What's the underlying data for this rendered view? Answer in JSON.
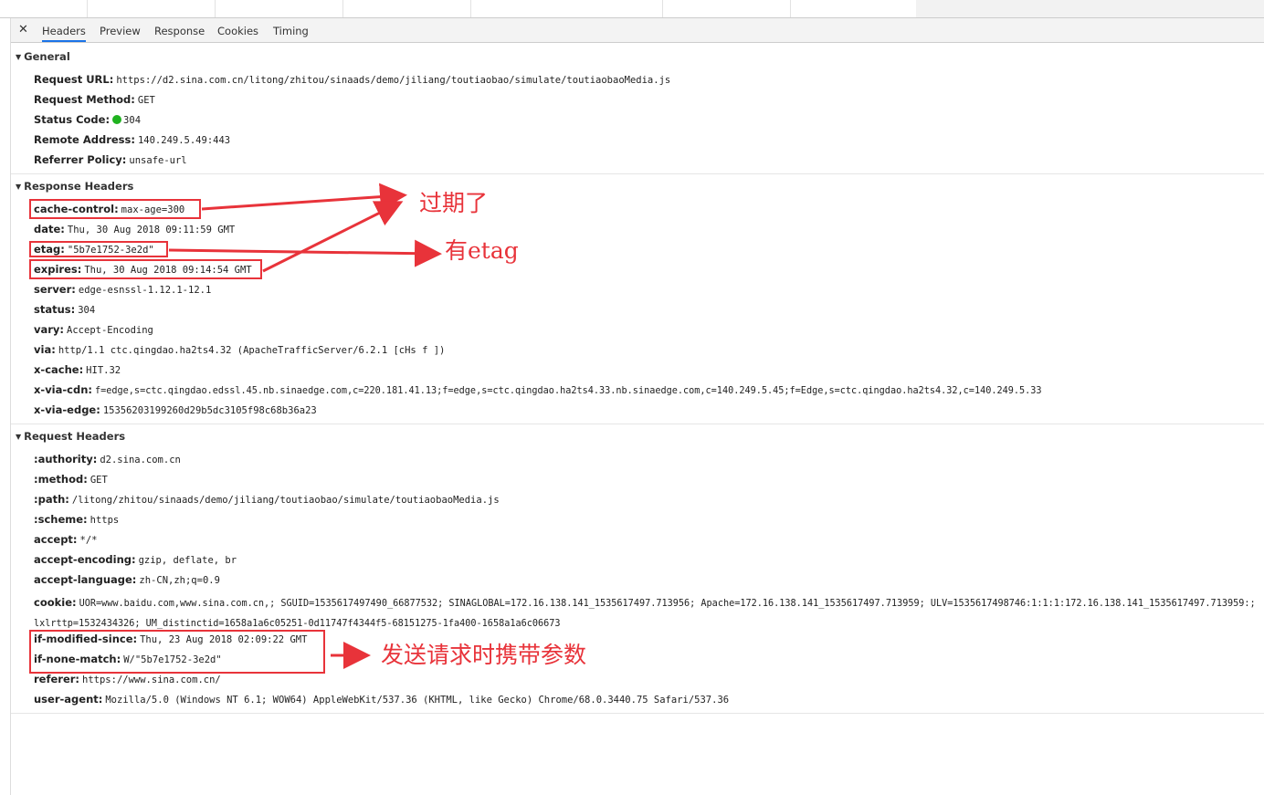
{
  "tabs": {
    "close": "✕",
    "headers": "Headers",
    "preview": "Preview",
    "response": "Response",
    "cookies": "Cookies",
    "timing": "Timing"
  },
  "general": {
    "title": "General",
    "rows": [
      {
        "key": "Request URL:",
        "value": "https://d2.sina.com.cn/litong/zhitou/sinaads/demo/jiliang/toutiaobao/simulate/toutiaobaoMedia.js"
      },
      {
        "key": "Request Method:",
        "value": "GET"
      },
      {
        "key": "Status Code:",
        "value": "304"
      },
      {
        "key": "Remote Address:",
        "value": "140.249.5.49:443"
      },
      {
        "key": "Referrer Policy:",
        "value": "unsafe-url"
      }
    ]
  },
  "response": {
    "title": "Response Headers",
    "rows": [
      {
        "key": "cache-control:",
        "value": "max-age=300"
      },
      {
        "key": "date:",
        "value": "Thu, 30 Aug 2018 09:11:59 GMT"
      },
      {
        "key": "etag:",
        "value": "\"5b7e1752-3e2d\""
      },
      {
        "key": "expires:",
        "value": "Thu, 30 Aug 2018 09:14:54 GMT"
      },
      {
        "key": "server:",
        "value": "edge-esnssl-1.12.1-12.1"
      },
      {
        "key": "status:",
        "value": "304"
      },
      {
        "key": "vary:",
        "value": "Accept-Encoding"
      },
      {
        "key": "via:",
        "value": "http/1.1 ctc.qingdao.ha2ts4.32 (ApacheTrafficServer/6.2.1 [cHs f ])"
      },
      {
        "key": "x-cache:",
        "value": "HIT.32"
      },
      {
        "key": "x-via-cdn:",
        "value": "f=edge,s=ctc.qingdao.edssl.45.nb.sinaedge.com,c=220.181.41.13;f=edge,s=ctc.qingdao.ha2ts4.33.nb.sinaedge.com,c=140.249.5.45;f=Edge,s=ctc.qingdao.ha2ts4.32,c=140.249.5.33"
      },
      {
        "key": "x-via-edge:",
        "value": "15356203199260d29b5dc3105f98c68b36a23"
      }
    ]
  },
  "request": {
    "title": "Request Headers",
    "rows": [
      {
        "key": ":authority:",
        "value": "d2.sina.com.cn"
      },
      {
        "key": ":method:",
        "value": "GET"
      },
      {
        "key": ":path:",
        "value": "/litong/zhitou/sinaads/demo/jiliang/toutiaobao/simulate/toutiaobaoMedia.js"
      },
      {
        "key": ":scheme:",
        "value": "https"
      },
      {
        "key": "accept:",
        "value": "*/*"
      },
      {
        "key": "accept-encoding:",
        "value": "gzip, deflate, br"
      },
      {
        "key": "accept-language:",
        "value": "zh-CN,zh;q=0.9"
      },
      {
        "key": "cookie:",
        "value": "UOR=www.baidu.com,www.sina.com.cn,; SGUID=1535617497490_66877532; SINAGLOBAL=172.16.138.141_1535617497.713956; Apache=172.16.138.141_1535617497.713959; ULV=1535617498746:1:1:1:172.16.138.141_1535617497.713959:; lxlrttp=1532434326; UM_distinctid=1658a1a6c05251-0d11747f4344f5-68151275-1fa400-1658a1a6c06673"
      },
      {
        "key": "if-modified-since:",
        "value": "Thu, 23 Aug 2018 02:09:22 GMT"
      },
      {
        "key": "if-none-match:",
        "value": "W/\"5b7e1752-3e2d\""
      },
      {
        "key": "referer:",
        "value": "https://www.sina.com.cn/"
      },
      {
        "key": "user-agent:",
        "value": "Mozilla/5.0 (Windows NT 6.1; WOW64) AppleWebKit/537.36 (KHTML, like Gecko) Chrome/68.0.3440.75 Safari/537.36"
      }
    ]
  },
  "annotations": {
    "expired": "过期了",
    "has_etag": "有etag",
    "request_params": "发送请求时携带参数"
  },
  "colors": {
    "annotation": "#e8333a",
    "status_ok": "#1fb21f",
    "active_tab": "#1a73e8"
  }
}
